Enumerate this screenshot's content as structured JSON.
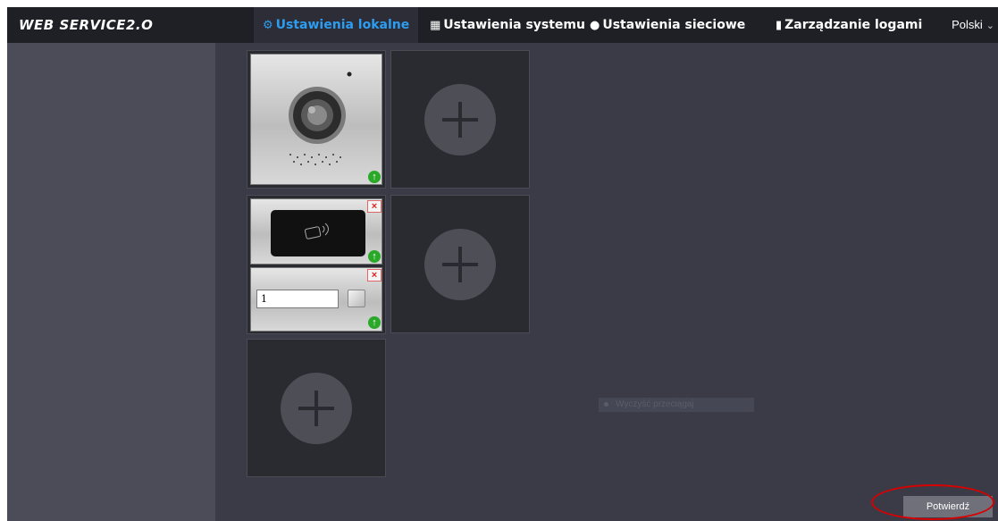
{
  "app": {
    "logo": "WEB SERVICE2.O"
  },
  "nav": {
    "items": [
      {
        "label": "Ustawienia lokalne",
        "icon": "gear-icon",
        "active": true
      },
      {
        "label": "Ustawienia systemu",
        "icon": "building-icon",
        "active": false
      },
      {
        "label": "Ustawienia sieciowe",
        "icon": "globe-icon",
        "active": false
      },
      {
        "label": "Zarządzanie logami",
        "icon": "document-icon",
        "active": false
      }
    ],
    "language": "Polski"
  },
  "modules": {
    "room_input_value": "1"
  },
  "hint": {
    "text": "Wyczyść przeciągaj"
  },
  "actions": {
    "confirm_label": "Potwierdź"
  },
  "colors": {
    "accent": "#2d9df1",
    "highlight_circle": "#d80000",
    "badge_green": "#2aa828"
  }
}
